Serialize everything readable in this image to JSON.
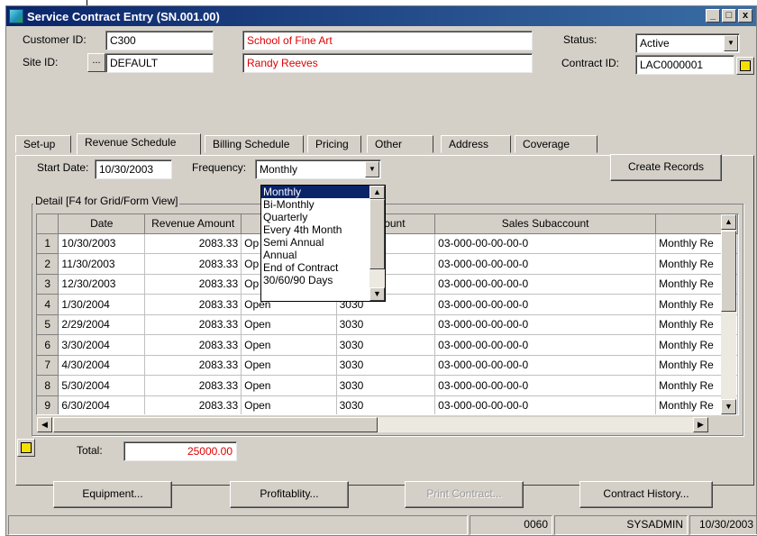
{
  "window": {
    "title": "Service Contract Entry (SN.001.00)",
    "min_glyph": "_",
    "max_glyph": "□",
    "close_glyph": "x"
  },
  "header": {
    "customer_id_label": "Customer ID:",
    "customer_id_value": "C300",
    "customer_name": "School of Fine Art",
    "site_id_label": "Site ID:",
    "site_lookup_label": "...",
    "site_id_value": "DEFAULT",
    "contact_name": "Randy Reeves",
    "status_label": "Status:",
    "status_value": "Active",
    "contract_id_label": "Contract ID:",
    "contract_id_value": "LAC0000001"
  },
  "tabs": [
    "Set-up",
    "Revenue Schedule",
    "Billing Schedule",
    "Pricing",
    "Other",
    "Address",
    "Coverage"
  ],
  "schedule": {
    "start_date_label": "Start Date:",
    "start_date_value": "10/30/2003",
    "frequency_label": "Frequency:",
    "frequency_value": "Monthly",
    "create_records_label": "Create Records",
    "frequency_options": [
      "Monthly",
      "Bi-Monthly",
      "Quarterly",
      "Every 4th Month",
      "Semi Annual",
      "Annual",
      "End of Contract",
      "30/60/90 Days"
    ]
  },
  "detail": {
    "group_title": "Detail [F4 for Grid/Form View]",
    "columns": [
      "Date",
      "Revenue Amount",
      "",
      "Account",
      "Sales Subaccount",
      ""
    ],
    "rows": [
      {
        "n": "1",
        "date": "10/30/2003",
        "amount": "2083.33",
        "status": "Op",
        "account": "",
        "sub": "03-000-00-00-00-0",
        "desc": "Monthly Re"
      },
      {
        "n": "2",
        "date": "11/30/2003",
        "amount": "2083.33",
        "status": "Op",
        "account": "",
        "sub": "03-000-00-00-00-0",
        "desc": "Monthly Re"
      },
      {
        "n": "3",
        "date": "12/30/2003",
        "amount": "2083.33",
        "status": "Op",
        "account": "",
        "sub": "03-000-00-00-00-0",
        "desc": "Monthly Re"
      },
      {
        "n": "4",
        "date": "1/30/2004",
        "amount": "2083.33",
        "status": "Open",
        "account": "3030",
        "sub": "03-000-00-00-00-0",
        "desc": "Monthly Re"
      },
      {
        "n": "5",
        "date": "2/29/2004",
        "amount": "2083.33",
        "status": "Open",
        "account": "3030",
        "sub": "03-000-00-00-00-0",
        "desc": "Monthly Re"
      },
      {
        "n": "6",
        "date": "3/30/2004",
        "amount": "2083.33",
        "status": "Open",
        "account": "3030",
        "sub": "03-000-00-00-00-0",
        "desc": "Monthly Re"
      },
      {
        "n": "7",
        "date": "4/30/2004",
        "amount": "2083.33",
        "status": "Open",
        "account": "3030",
        "sub": "03-000-00-00-00-0",
        "desc": "Monthly Re"
      },
      {
        "n": "8",
        "date": "5/30/2004",
        "amount": "2083.33",
        "status": "Open",
        "account": "3030",
        "sub": "03-000-00-00-00-0",
        "desc": "Monthly Re"
      },
      {
        "n": "9",
        "date": "6/30/2004",
        "amount": "2083.33",
        "status": "Open",
        "account": "3030",
        "sub": "03-000-00-00-00-0",
        "desc": "Monthly Re"
      }
    ]
  },
  "totals": {
    "total_label": "Total:",
    "total_value": "25000.00"
  },
  "buttons": {
    "equipment": "Equipment...",
    "profitability": "Profitablity...",
    "print_contract": "Print Contract...",
    "contract_history": "Contract History..."
  },
  "statusbar": {
    "code": "0060",
    "user": "SYSADMIN",
    "date": "10/30/2003"
  },
  "icons": {
    "app": "app-icon",
    "note": "note-icon",
    "dropdown": "chevron-down-icon",
    "up": "scroll-up-icon",
    "down": "scroll-down-icon",
    "left": "scroll-left-icon",
    "right": "scroll-right-icon"
  },
  "colors": {
    "title_bar": "#0a246a",
    "required_text": "#e00000",
    "note_yellow": "#f5e100",
    "face": "#d4d0c8"
  }
}
